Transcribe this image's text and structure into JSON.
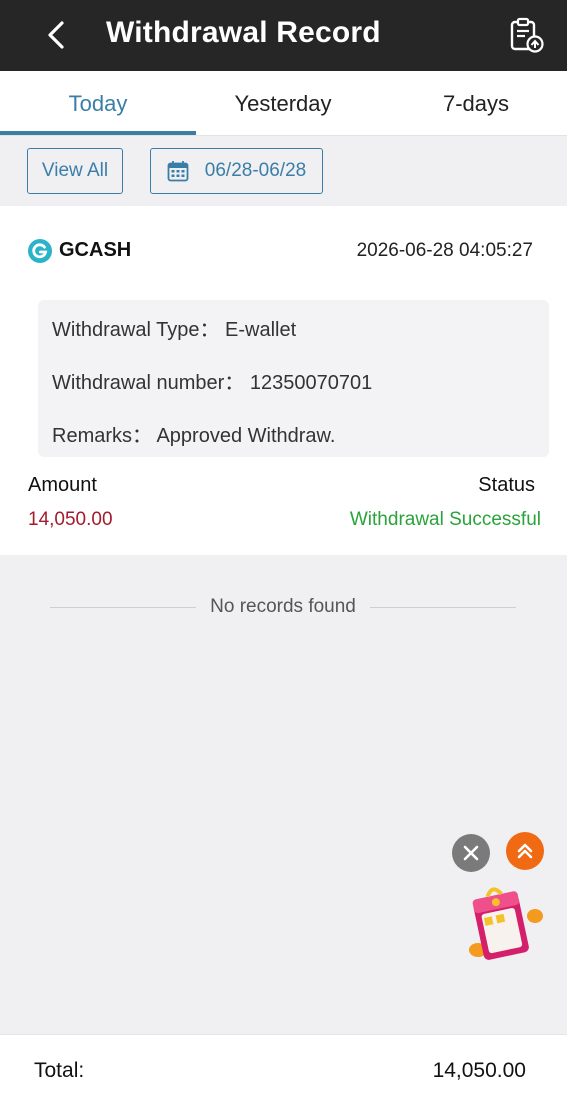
{
  "header": {
    "title": "Withdrawal Record",
    "back_icon": "chevron-left-icon",
    "action_icon": "clipboard-upload-icon"
  },
  "tabs": [
    {
      "label": "Today",
      "active": true
    },
    {
      "label": "Yesterday",
      "active": false
    },
    {
      "label": "7-days",
      "active": false
    }
  ],
  "filters": {
    "view_all_label": "View All",
    "date_range": "06/28-06/28",
    "date_icon": "calendar-icon"
  },
  "record": {
    "method": "GCASH",
    "method_icon": "gcash-logo-icon",
    "timestamp": "2026-06-28 04:05:27",
    "withdrawal_type_label": "Withdrawal Type：",
    "withdrawal_type_value": "E-wallet",
    "withdrawal_number_label": "Withdrawal number：",
    "withdrawal_number_value": "12350070701",
    "remarks_label": "Remarks：",
    "remarks_value": "Approved Withdraw.",
    "amount_label": "Amount",
    "amount_value": "14,050.00",
    "status_label": "Status",
    "status_value": "Withdrawal Successful"
  },
  "empty_state": "No records found",
  "footer": {
    "total_label": "Total:",
    "total_value": "14,050.00"
  },
  "colors": {
    "accent": "#3a7ea8",
    "header_bg": "#262626",
    "amount": "#a31b2d",
    "status_success": "#2aa33a",
    "scroll_top_fab": "#f06a14"
  }
}
